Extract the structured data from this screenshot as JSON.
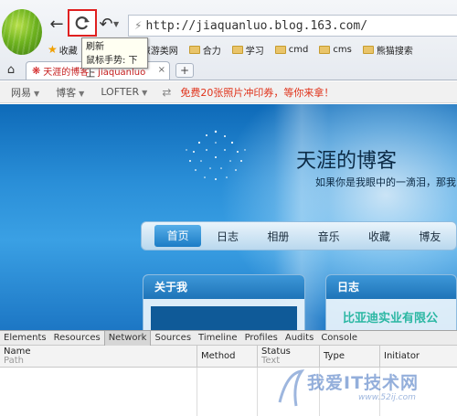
{
  "browser": {
    "url": "http://jiaquanluo.blog.163.com/",
    "tooltip": {
      "line1": "刷新",
      "line2": "鼠标手势: 下上"
    },
    "bookmarks": {
      "favorites_label": "收藏",
      "items": [
        "旅游类网",
        "合力",
        "学习",
        "cmd",
        "cms",
        "熊猫搜索"
      ]
    },
    "tab": {
      "title": "天涯的博客 - jiaquanluo",
      "close": "×"
    },
    "new_tab": "+"
  },
  "site_bar": {
    "items": [
      "网易",
      "博客",
      "LOFTER"
    ],
    "promo": "免费20张照片冲印券，等你来拿！"
  },
  "blog": {
    "title": "天涯的博客",
    "subtitle": "如果你是我眼中的一滴泪，那我",
    "nav": [
      "首页",
      "日志",
      "相册",
      "音乐",
      "收藏",
      "博友"
    ],
    "active_nav": "首页",
    "panel_about": "关于我",
    "panel_diary": "日志",
    "diary_article": "比亚迪实业有限公"
  },
  "devtools": {
    "tabs": [
      "Elements",
      "Resources",
      "Network",
      "Sources",
      "Timeline",
      "Profiles",
      "Audits",
      "Console"
    ],
    "active_tab": "Network",
    "columns": {
      "name": "Name",
      "name_sub": "Path",
      "method": "Method",
      "status": "Status",
      "status_sub": "Text",
      "type": "Type",
      "initiator": "Initiator"
    }
  },
  "watermark": {
    "text": "我爱IT技术网",
    "url": "www.52ij.com"
  },
  "colors": {
    "refresh_highlight": "#e02020",
    "promo_red": "#e0331b",
    "blog_blue": "#1c76c4",
    "article_teal": "#2bb7a3"
  }
}
